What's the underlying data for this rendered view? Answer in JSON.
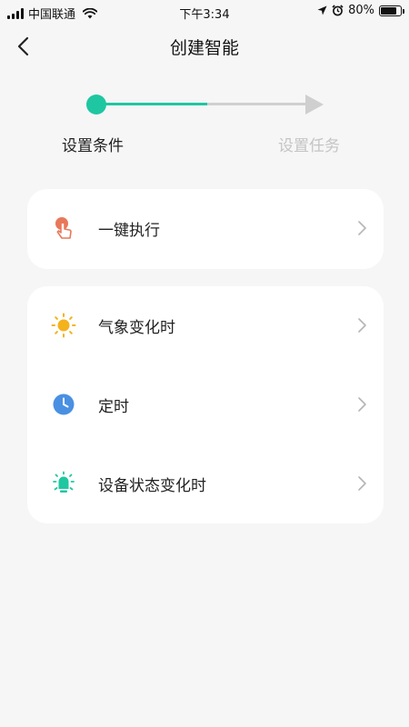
{
  "status_bar": {
    "carrier": "中国联通",
    "time": "下午3:34",
    "battery_text": "80%",
    "battery_level": 0.8
  },
  "header": {
    "title": "创建智能"
  },
  "stepper": {
    "steps": [
      {
        "label": "设置条件",
        "active": true
      },
      {
        "label": "设置任务",
        "active": false
      }
    ],
    "active_color": "#1ec7a1",
    "inactive_color": "#cfcfcf"
  },
  "cards": {
    "manual": {
      "items": [
        {
          "label": "一键执行",
          "icon": "tap-hand-icon",
          "color": "#e8785a"
        }
      ]
    },
    "auto": {
      "items": [
        {
          "label": "气象变化时",
          "icon": "sun-icon",
          "color": "#f4b21c"
        },
        {
          "label": "定时",
          "icon": "clock-icon",
          "color": "#4a90e2"
        },
        {
          "label": "设备状态变化时",
          "icon": "bulb-icon",
          "color": "#1ec7a1"
        }
      ]
    }
  }
}
